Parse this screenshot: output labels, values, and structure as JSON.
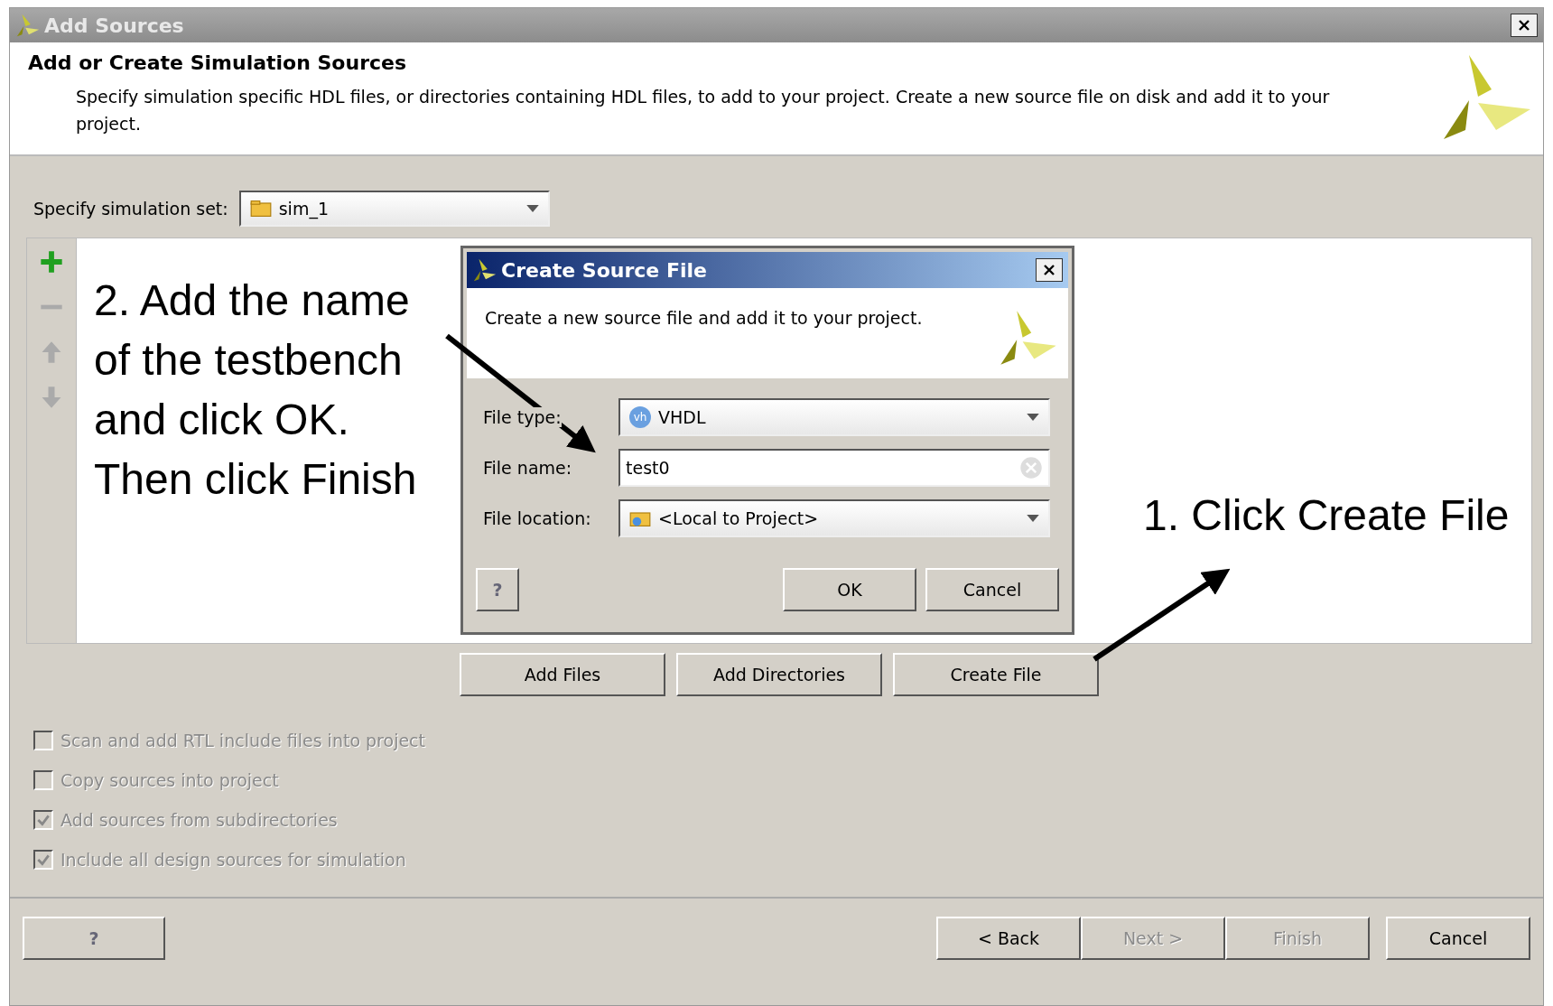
{
  "window": {
    "title": "Add Sources"
  },
  "header": {
    "title": "Add or Create Simulation Sources",
    "description": "Specify simulation specific HDL files, or directories containing HDL files, to add to your project. Create a new source file on disk and add it to your project."
  },
  "sim_set": {
    "label": "Specify simulation set:",
    "value": "sim_1"
  },
  "create_dialog": {
    "title": "Create Source File",
    "description": "Create a new source file and add it to your project.",
    "fields": [
      {
        "kind": "dropdown",
        "icon_text": "vh",
        "label": "File type:",
        "value": "VHDL"
      },
      {
        "kind": "text",
        "label": "File name:",
        "value": "test0"
      },
      {
        "kind": "dropdown",
        "label": "File location:",
        "value": "<Local to Project>"
      }
    ],
    "help": "?",
    "buttons": [
      "OK",
      "Cancel"
    ]
  },
  "action_buttons": [
    "Add Files",
    "Add Directories",
    "Create File"
  ],
  "options": [
    {
      "label": "Scan and add RTL include files into project",
      "checked": false,
      "disabled": true
    },
    {
      "label": "Copy sources into project",
      "checked": false,
      "disabled": true
    },
    {
      "label": "Add sources from subdirectories",
      "checked": true,
      "disabled": true
    },
    {
      "label": "Include all design sources for simulation",
      "checked": true,
      "disabled": true
    }
  ],
  "footer": {
    "help": "?",
    "buttons": [
      {
        "label": "< Back",
        "disabled": false
      },
      {
        "label": "Next >",
        "disabled": true
      },
      {
        "label": "Finish",
        "disabled": true
      },
      {
        "label": "Cancel",
        "disabled": false
      }
    ]
  },
  "annotations": [
    {
      "lines": [
        "2. Add the name",
        "of the testbench",
        "and click OK.",
        "Then click Finish"
      ]
    },
    {
      "lines": [
        "1. Click Create File"
      ]
    }
  ]
}
